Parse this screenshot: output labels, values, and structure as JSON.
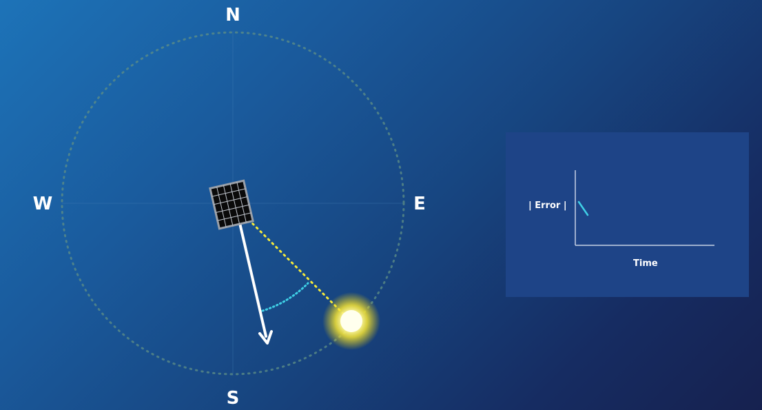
{
  "compass": {
    "north": "N",
    "south": "S",
    "east": "E",
    "west": "W"
  },
  "error_plot": {
    "ylabel": "| Error |",
    "xlabel": "Time"
  },
  "colors": {
    "background_light": "#1d73b8",
    "background_dark": "#16214f",
    "sun_line": "#f5ea3a",
    "error_arc": "#3fd0e6",
    "error_trace": "#3fd0e6",
    "panel_background": "#1e4487",
    "compass_ring": "#5f8f86"
  }
}
